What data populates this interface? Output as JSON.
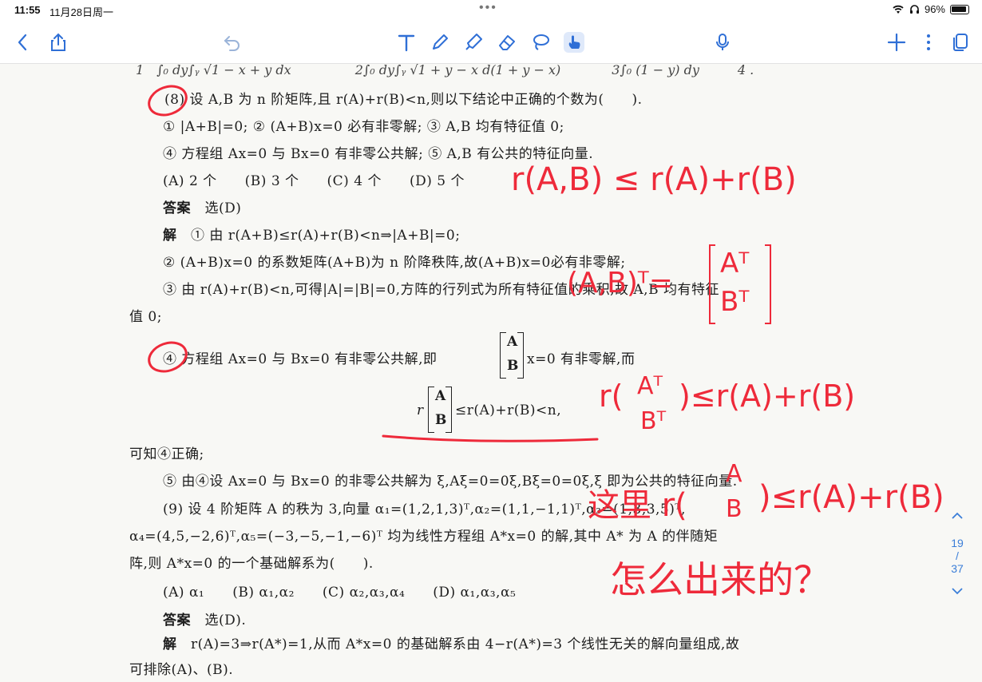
{
  "status": {
    "time": "11:55",
    "date": "11月28日周一",
    "battery": "96%"
  },
  "toolbar": {
    "icons": [
      "back-icon",
      "share-icon",
      "undo-icon",
      "text-icon",
      "pen-icon",
      "highlighter-icon",
      "eraser-icon",
      "lasso-icon",
      "touch-icon",
      "mic-icon",
      "add-icon",
      "more-icon",
      "pages-icon"
    ],
    "accent": "#2f6fd6"
  },
  "doc": {
    "q8": "(8) 设 A,B 为 n 阶矩阵,且 r(A)+r(B)<n,则以下结论中正确的个数为(　　).",
    "q8_s1": "① |A+B|=0; ② (A+B)x=0 必有非零解; ③ A,B 均有特征值 0;",
    "q8_s2": "④ 方程组 Ax=0 与 Bx=0 有非零公共解; ⑤ A,B 有公共的特征向量.",
    "q8_opts": "(A) 2 个　　(B) 3 个　　(C) 4 个　　(D) 5 个",
    "q8_ans_label": "答案",
    "q8_ans": "选(D)",
    "sol_label": "解",
    "sol1": "① 由 r(A+B)≤r(A)+r(B)<n⇒|A+B|=0;",
    "sol2": "② (A+B)x=0 的系数矩阵(A+B)为 n 阶降秩阵,故(A+B)x=0必有非零解;",
    "sol3": "③ 由 r(A)+r(B)<n,可得|A|=|B|=0,方阵的行列式为所有特征值的乘积,故 A,B 均有特征",
    "sol3b": "值 0;",
    "sol4a": "④ 方程组 Ax=0 与 Bx=0 有非零公共解,即",
    "sol4b": "x=0 有非零解,而",
    "mat_top": "A",
    "mat_bot": "B",
    "rank_r": "r",
    "rank_rest": "≤r(A)+r(B)<n,",
    "sol4c": "可知④正确;",
    "sol5": "⑤ 由④设 Ax=0 与 Bx=0 的非零公共解为 ξ,Aξ=0=0ξ,Bξ=0=0ξ,ξ 即为公共的特征向量.",
    "q9": "(9) 设 4 阶矩阵 A 的秩为 3,向量 α₁=(1,2,1,3)ᵀ,α₂=(1,1,−1,1)ᵀ,α₃=(1,3,3,5)ᵀ,",
    "q9b": "α₄=(4,5,−2,6)ᵀ,α₅=(−3,−5,−1,−6)ᵀ 均为线性方程组 A*x=0 的解,其中 A* 为 A 的伴随矩",
    "q9c": "阵,则 A*x=0 的一个基础解系为(　　).",
    "q9_opts": "(A) α₁　　(B) α₁,α₂　　(C) α₂,α₃,α₄　　(D) α₁,α₃,α₅",
    "q9_ans_label": "答案",
    "q9_ans": "选(D).",
    "q9_sol": "r(A)=3⇒r(A*)=1,从而 A*x=0 的基础解系由 4−r(A*)=3 个线性无关的解向量组成,故",
    "q9_sol2": "可排除(A)、(B)."
  },
  "ink": {
    "color": "#ee2a3a",
    "note1": "r(A,B) ≤ r(A)+r(B)",
    "note2a": "(A,B)ᵀ=",
    "note2_top": "Aᵀ",
    "note2_bot": "Bᵀ",
    "note3a": "r(",
    "note3b": ")≤r(A)+r(B)",
    "note4a": "这里 r(",
    "note4_top": "A",
    "note4_bot": "B",
    "note4b": ")≤r(A)+r(B)",
    "note5": "怎么出来的？",
    "mark1": "⑧",
    "mark2": "④"
  },
  "pager": {
    "current": "19",
    "sep": "/",
    "total": "37"
  }
}
